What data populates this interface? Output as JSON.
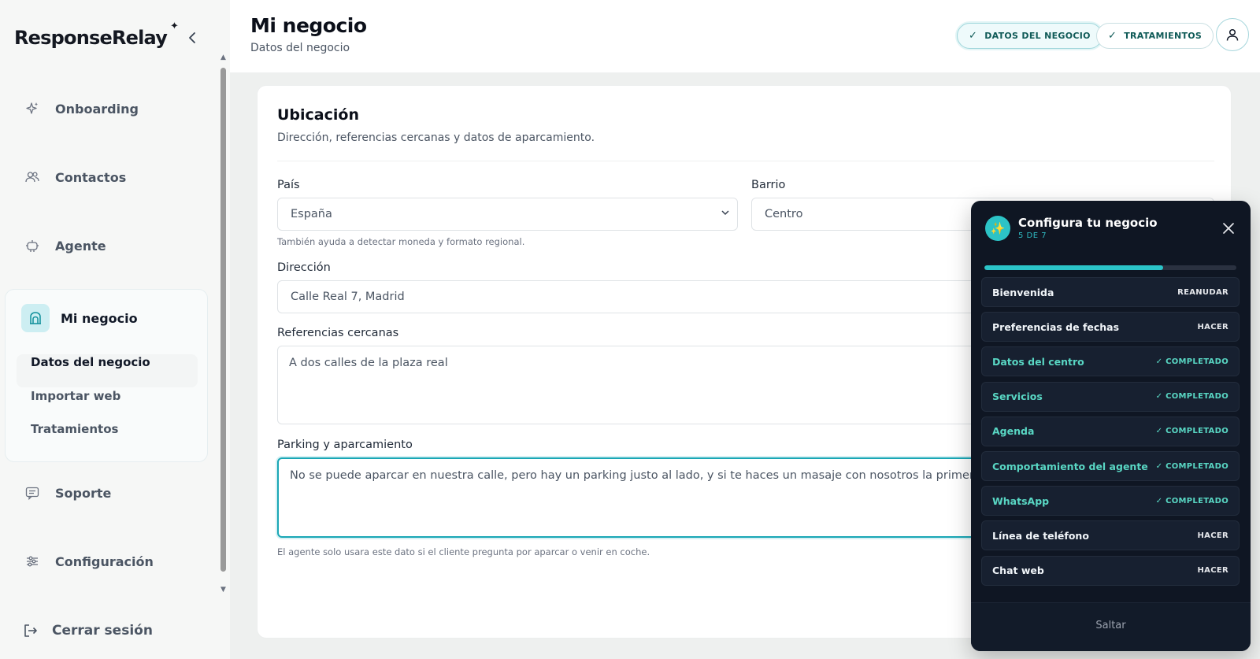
{
  "app": {
    "logo": "ResponseRelay",
    "logo_spark": "✦"
  },
  "sidebar": {
    "items": [
      {
        "label": "Onboarding",
        "icon": "sparkle-icon"
      },
      {
        "label": "Contactos",
        "icon": "users-icon"
      },
      {
        "label": "Agente",
        "icon": "robot-icon"
      },
      {
        "label": "Soporte",
        "icon": "chat-icon"
      },
      {
        "label": "Configuración",
        "icon": "sliders-icon"
      }
    ],
    "group": {
      "label": "Mi negocio",
      "icon": "storefront-icon",
      "subitems": [
        "Datos del negocio",
        "Importar web",
        "Tratamientos"
      ],
      "active": "Datos del negocio"
    },
    "logout": "Cerrar sesión"
  },
  "header": {
    "title": "Mi negocio",
    "subtitle": "Datos del negocio",
    "chips": [
      "DATOS DEL NEGOCIO",
      "TRATAMIENTOS"
    ],
    "check": "✓"
  },
  "card": {
    "title": "Ubicación",
    "subtitle": "Dirección, referencias cercanas y datos de aparcamiento.",
    "fields": {
      "pais": {
        "label": "País",
        "value": "España",
        "hint": "También ayuda a detectar moneda y formato regional."
      },
      "barrio": {
        "label": "Barrio",
        "value": "Centro"
      },
      "direccion": {
        "label": "Dirección",
        "value": "Calle Real 7, Madrid"
      },
      "referencias": {
        "label": "Referencias cercanas",
        "value": "A dos calles de la plaza real"
      },
      "parking": {
        "label": "Parking y aparcamiento",
        "value": "No se puede aparcar en nuestra calle, pero hay un parking justo al lado, y  si te haces un masaje con nosotros la primera hora es gratis",
        "hint": "El agente solo usara este dato si el cliente pregunta por aparcar o venir en coche."
      }
    }
  },
  "panel": {
    "title": "Configura tu negocio",
    "step_label": "5 DE 7",
    "progress": 0.71,
    "accent": "#2bc4c8",
    "done_color": "#59d7c4",
    "steps": [
      {
        "name": "Bienvenida",
        "status": "REANUDAR",
        "done": false
      },
      {
        "name": "Preferencias de fechas",
        "status": "HACER",
        "done": false
      },
      {
        "name": "Datos del centro",
        "status": "✓ COMPLETADO",
        "done": true
      },
      {
        "name": "Servicios",
        "status": "✓ COMPLETADO",
        "done": true
      },
      {
        "name": "Agenda",
        "status": "✓ COMPLETADO",
        "done": true
      },
      {
        "name": "Comportamiento del agente",
        "status": "✓ COMPLETADO",
        "done": true
      },
      {
        "name": "WhatsApp",
        "status": "✓ COMPLETADO",
        "done": true
      },
      {
        "name": "Línea de teléfono",
        "status": "HACER",
        "done": false
      },
      {
        "name": "Chat web",
        "status": "HACER",
        "done": false
      }
    ],
    "skip": "Saltar"
  }
}
